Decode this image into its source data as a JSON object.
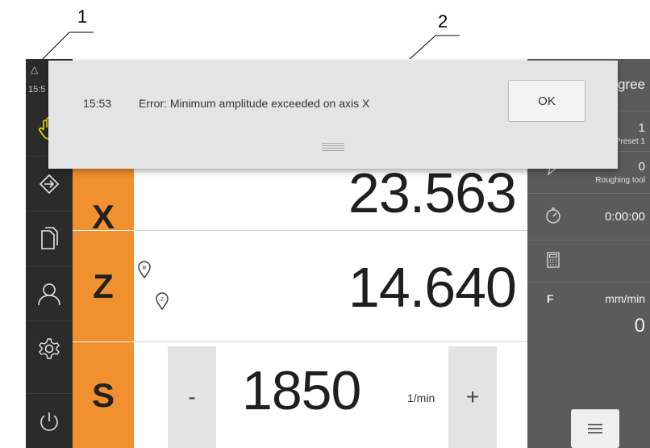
{
  "callouts": {
    "one": "1",
    "two": "2"
  },
  "status": {
    "time": "15:5",
    "warning_icon": "triangle-warning-icon"
  },
  "sidebar": {
    "items": [
      {
        "name": "manual-mode",
        "icon": "hand-icon"
      },
      {
        "name": "setup",
        "icon": "arrow-right-icon"
      },
      {
        "name": "file-management",
        "icon": "files-icon"
      },
      {
        "name": "user",
        "icon": "user-icon"
      },
      {
        "name": "settings",
        "icon": "gear-icon"
      },
      {
        "name": "power",
        "icon": "power-icon"
      }
    ]
  },
  "axes": [
    {
      "label": "X",
      "value": "23.563"
    },
    {
      "label": "Z",
      "value": "14.640"
    }
  ],
  "spindle": {
    "label": "S",
    "minus": "-",
    "plus": "+",
    "value": "1850",
    "unit": "1/min"
  },
  "right_panel": {
    "header_fragment": "gree",
    "preset_number": "1",
    "preset_label": "Preset 1",
    "tool_number": "0",
    "tool_label": "Roughing tool",
    "timer": "0:00:00",
    "feed_label": "F",
    "feed_unit": "mm/min",
    "feed_value": "0"
  },
  "dialog": {
    "time": "15:53",
    "message": "Error: Minimum amplitude exceeded on axis X",
    "ok_label": "OK"
  },
  "colors": {
    "accent_orange": "#f0902e",
    "sidebar_bg": "#2b2b2b",
    "panel_bg": "#5b5b5b",
    "hand_icon_yellow": "#e2d800"
  }
}
